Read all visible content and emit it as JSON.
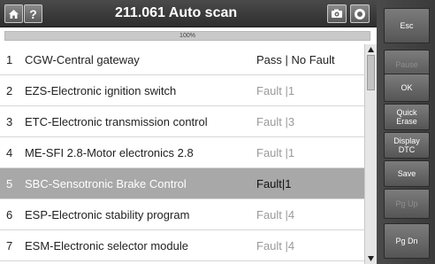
{
  "header": {
    "title": "211.061    Auto scan",
    "home_icon": "home-icon",
    "help_label": "?",
    "camera_icon": "camera-icon",
    "record_icon": "record-icon"
  },
  "progress": {
    "label": "100%",
    "value": 1.0
  },
  "rows": [
    {
      "num": "1",
      "name": "CGW-Central gateway",
      "status": "Pass | No Fault",
      "kind": "pass"
    },
    {
      "num": "2",
      "name": "EZS-Electronic ignition switch",
      "status": "Fault |1",
      "kind": "fault"
    },
    {
      "num": "3",
      "name": "ETC-Electronic transmission control",
      "status": "Fault |3",
      "kind": "fault"
    },
    {
      "num": "4",
      "name": "ME-SFI 2.8-Motor electronics 2.8",
      "status": "Fault |1",
      "kind": "fault"
    },
    {
      "num": "5",
      "name": "SBC-Sensotronic Brake Control",
      "status": "Fault|1",
      "kind": "selected"
    },
    {
      "num": "6",
      "name": "ESP-Electronic stability program",
      "status": "Fault |4",
      "kind": "fault"
    },
    {
      "num": "7",
      "name": "ESM-Electronic selector module",
      "status": "Fault |4",
      "kind": "fault"
    }
  ],
  "buttons": {
    "esc": "Esc",
    "pause": "Pause",
    "ok": "OK",
    "quick_erase_1": "Quick",
    "quick_erase_2": "Erase",
    "display_dtc_1": "Display",
    "display_dtc_2": "DTC",
    "save": "Save",
    "pg_up": "Pg Up",
    "pg_dn": "Pg Dn"
  }
}
